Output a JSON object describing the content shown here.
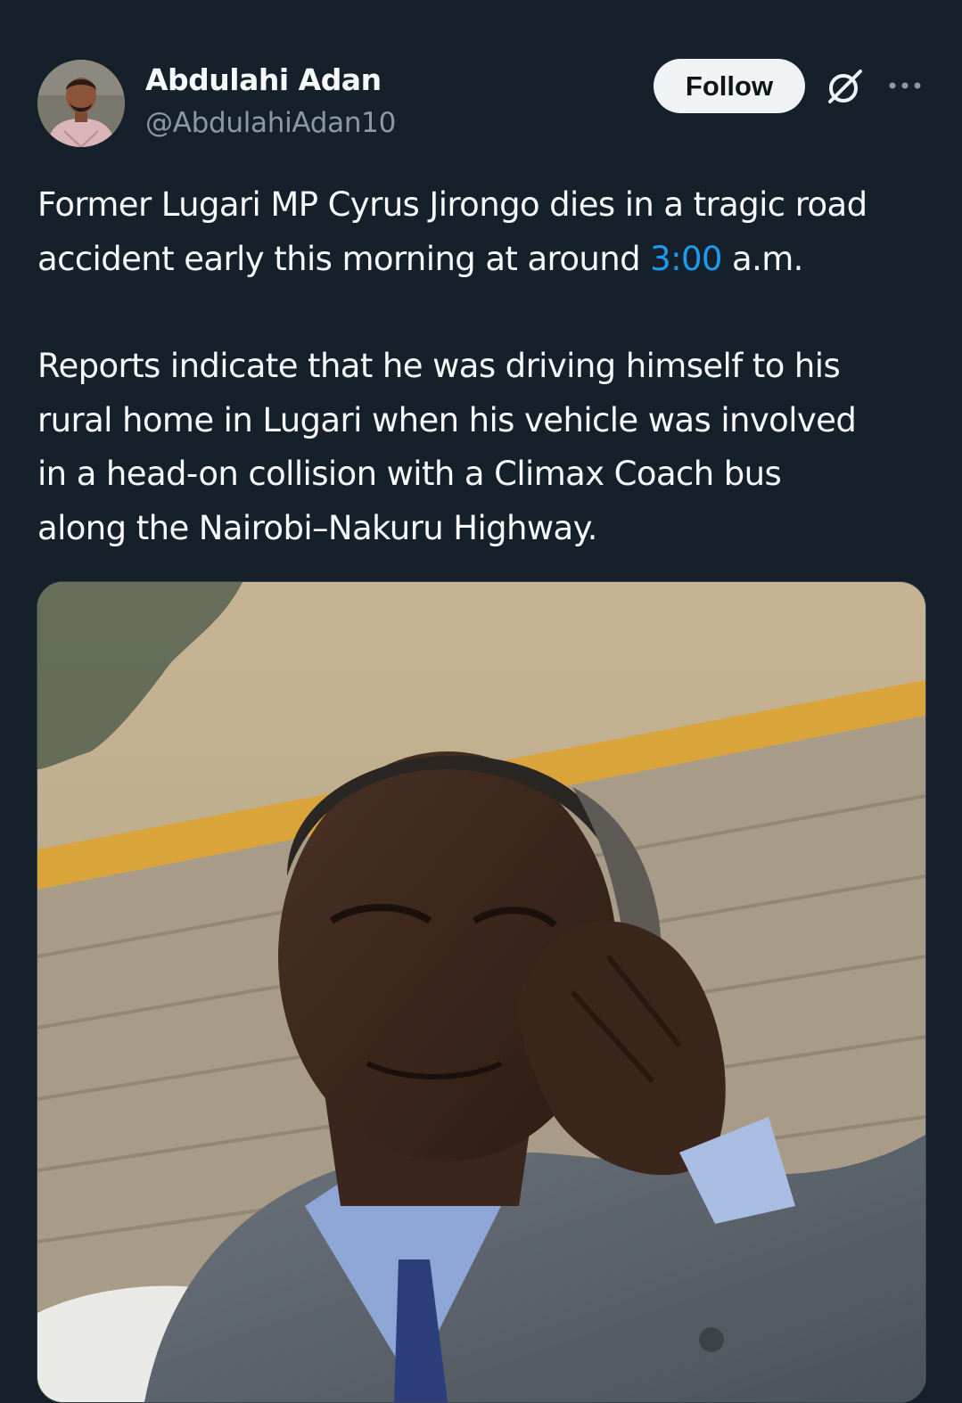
{
  "author": {
    "display_name": "Abdulahi Adan",
    "handle": "@AbdulahiAdan10"
  },
  "actions": {
    "follow_label": "Follow",
    "grok_icon": "grok-icon",
    "more_icon": "more-icon"
  },
  "tweet": {
    "p1_before": "Former Lugari MP Cyrus Jirongo dies in a tragic road",
    "p1_line2_before": "accident early this morning at around ",
    "p1_link": "3:00",
    "p1_line2_after": " a.m.",
    "p2_lines": [
      "Reports indicate that he was driving himself to his",
      "rural home in Lugari when his vehicle was involved",
      "in a head-on collision with a Climax Coach bus",
      "along the Nairobi–Nakuru Highway."
    ]
  },
  "colors": {
    "background": "#15202b",
    "text": "#f7f9f9",
    "secondary": "#8b98a5",
    "link": "#1d9bf0",
    "follow_bg": "#eff3f4"
  }
}
